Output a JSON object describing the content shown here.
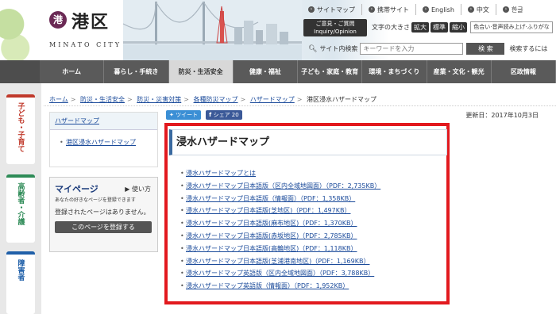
{
  "header": {
    "logo_mark": "港",
    "logo_text": "港区",
    "logo_sub": "MINATO CITY",
    "top_links": [
      {
        "icon": "sitemap-icon",
        "label": "サイトマップ"
      },
      {
        "icon": "mobile-icon",
        "label": "携帯サイト"
      },
      {
        "icon": "globe-icon",
        "label": "English"
      },
      {
        "icon": "globe-icon",
        "label": "中文"
      },
      {
        "icon": "globe-icon",
        "label": "한글"
      }
    ],
    "inquiry_line1": "ご意見・ご質問",
    "inquiry_line2": "Inquiry/Opinion",
    "font_size_label": "文字の大きさ",
    "font_size_buttons": [
      "拡大",
      "標準",
      "縮小"
    ],
    "speech_label": "色合い·音声読み上げ·ふりがな",
    "search_label": "サイト内検索",
    "search_placeholder": "キーワードを入力",
    "search_button": "検 索",
    "advanced_search": "検索するには"
  },
  "nav": {
    "items": [
      "ホーム",
      "暮らし・手続き",
      "防災・生活安全",
      "健康・福祉",
      "子ども・家庭・教育",
      "環境・まちづくり",
      "産業・文化・観光",
      "区政情報"
    ],
    "active_index": 2
  },
  "side_tabs": [
    {
      "label": "子ども・子育て",
      "color": "#c0392b"
    },
    {
      "label": "高齢者・介護",
      "color": "#2e8b57"
    },
    {
      "label": "障害者",
      "color": "#1f5fa8"
    }
  ],
  "breadcrumb": [
    "ホーム",
    "防災・生活安全",
    "防災・災害対策",
    "各種防災マップ",
    "ハザードマップ",
    "港区浸水ハザードマップ"
  ],
  "sidebar": {
    "title": "ハザードマップ",
    "item": "港区浸水ハザードマップ"
  },
  "mypage": {
    "title": "マイページ",
    "howto": "使い方",
    "subtitle": "あなたの好きなページを登録できます",
    "empty": "登録されたページはありません。",
    "button": "このページを登録する"
  },
  "share": {
    "tweet": "ツイート",
    "fb": "シェア 20"
  },
  "updated": "更新日：2017年10月3日",
  "main": {
    "heading": "浸水ハザードマップ",
    "links": [
      "浸水ハザードマップとは",
      "浸水ハザードマップ日本語版（区内全域地図面）（PDF：2,735KB）",
      "浸水ハザードマップ日本語版（情報面）（PDF：1,358KB）",
      "浸水ハザードマップ日本語版(芝地区)（PDF：1,497KB）",
      "浸水ハザードマップ日本語版(麻布地区)（PDF：1,370KB）",
      "浸水ハザードマップ日本語版(赤坂地区)（PDF：2,785KB）",
      "浸水ハザードマップ日本語版(高輪地区)（PDF：1,118KB）",
      "浸水ハザードマップ日本語版(芝浦港南地区)（PDF：1,169KB）",
      "浸水ハザードマップ英語版（区内全域地図面）（PDF：3,788KB）",
      "浸水ハザードマップ英語版（情報面）（PDF：1,952KB）"
    ]
  },
  "colors": {
    "nav_bg": "#5a5a5a",
    "highlight": "#e2191e",
    "link": "#1a4a9a",
    "logo": "#6b2a55"
  }
}
